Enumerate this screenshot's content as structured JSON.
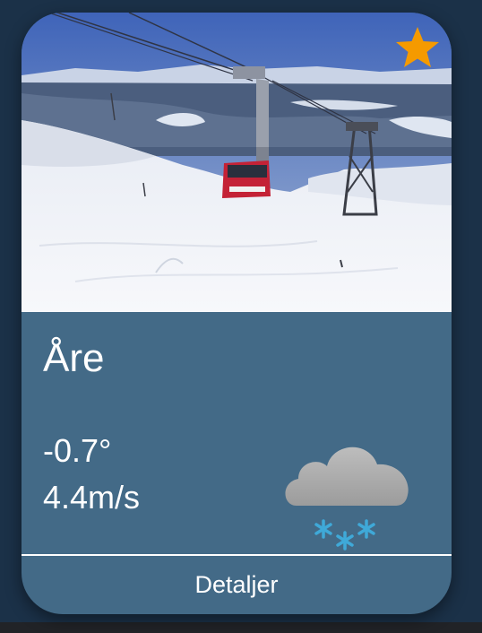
{
  "card": {
    "location": "Åre",
    "temperature": "-0.7°",
    "wind": "4.4m/s",
    "details_label": "Detaljer",
    "weather_icon": "cloud-snow-icon",
    "favorite_icon": "star-icon",
    "favorite_color": "#f59a00"
  },
  "colors": {
    "page_background": "#1b3148",
    "card_background": "#436a87"
  }
}
